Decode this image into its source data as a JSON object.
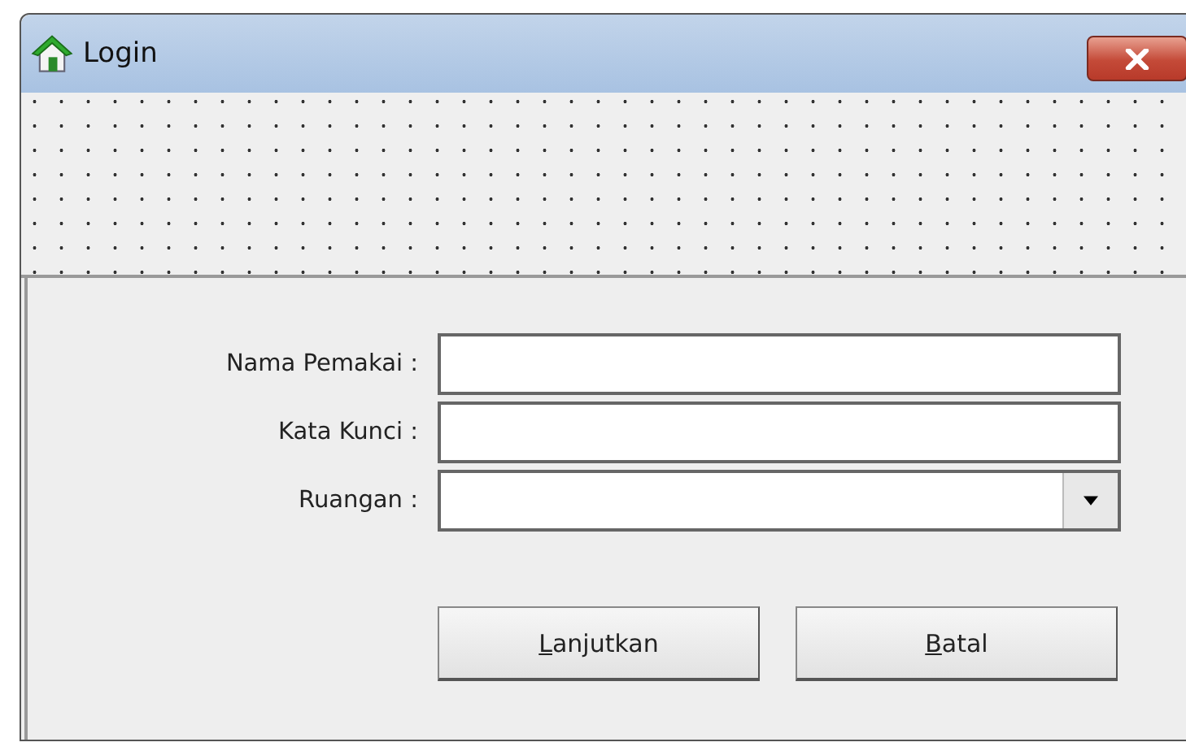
{
  "window": {
    "title": "Login"
  },
  "fields": [
    {
      "kind": "text",
      "label": "Nama Pemakai :"
    },
    {
      "kind": "text",
      "label": "Kata Kunci :"
    },
    {
      "kind": "dropdown",
      "label": "Ruangan :"
    }
  ],
  "buttons": [
    {
      "label": "Lanjutkan",
      "access_key_underlined": true
    },
    {
      "label": "Batal",
      "access_key_underlined": true
    }
  ]
}
